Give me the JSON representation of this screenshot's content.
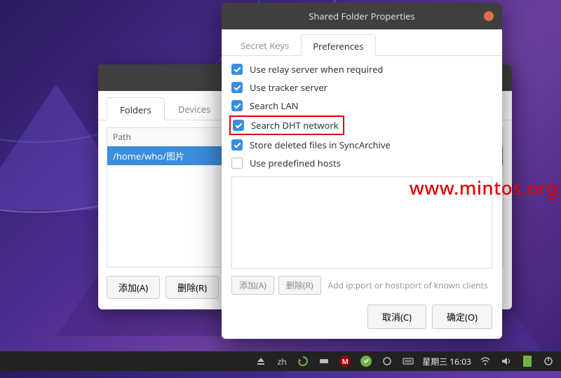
{
  "back_window": {
    "tabs": {
      "folders": "Folders",
      "devices": "Devices"
    },
    "list_header": "Path",
    "list_row": "/home/who/图片",
    "buttons": {
      "add": "添加(A)",
      "remove": "删除(R)"
    }
  },
  "dialog": {
    "title": "Shared Folder Properties",
    "tabs": {
      "secret_keys": "Secret Keys",
      "preferences": "Preferences"
    },
    "options": {
      "relay": {
        "label": "Use relay server when required",
        "checked": true
      },
      "tracker": {
        "label": "Use tracker server",
        "checked": true
      },
      "lan": {
        "label": "Search LAN",
        "checked": true
      },
      "dht": {
        "label": "Search DHT network",
        "checked": true,
        "highlighted": true
      },
      "archive": {
        "label": "Store deleted files in SyncArchive",
        "checked": true
      },
      "hosts": {
        "label": "Use predefined hosts",
        "checked": false
      }
    },
    "hosts_controls": {
      "add": "添加(A)",
      "remove": "删除(R)",
      "hint": "Add ip:port or host:port of known clients"
    },
    "buttons": {
      "cancel": "取消(C)",
      "ok": "确定(O)"
    }
  },
  "watermark": "www.mintos.org",
  "taskbar": {
    "ime": "zh",
    "m_label": "M",
    "clock": "星期三 16:03"
  }
}
